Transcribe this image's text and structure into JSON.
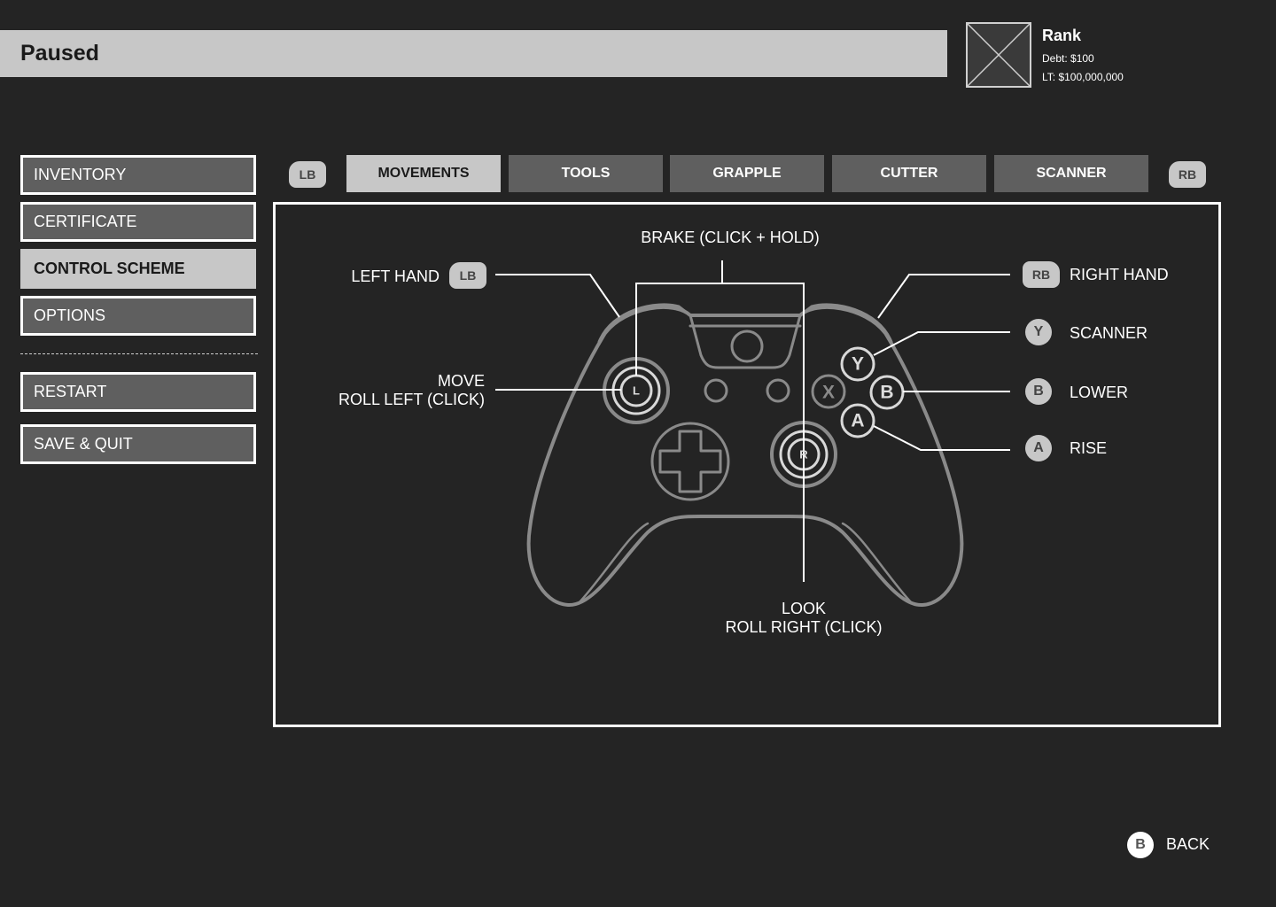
{
  "header": {
    "title": "Paused"
  },
  "rank": {
    "title": "Rank",
    "debt": "Debt: $100",
    "lifetime": "LT: $100,000,000"
  },
  "menu": {
    "items": [
      "INVENTORY",
      "CERTIFICATE",
      "CONTROL SCHEME",
      "OPTIONS"
    ],
    "active": "CONTROL SCHEME",
    "restart": "RESTART",
    "save_quit": "SAVE & QUIT"
  },
  "tabs": {
    "prev_bumper": "LB",
    "next_bumper": "RB",
    "items": [
      "MOVEMENTS",
      "TOOLS",
      "GRAPPLE",
      "CUTTER",
      "SCANNER"
    ],
    "active": "MOVEMENTS"
  },
  "controls": {
    "brake": "BRAKE (CLICK + HOLD)",
    "left_hand": "LEFT HAND",
    "left_hand_button": "LB",
    "right_hand": "RIGHT HAND",
    "right_hand_button": "RB",
    "move_line1": "MOVE",
    "move_line2": "ROLL LEFT (CLICK)",
    "look_line1": "LOOK",
    "look_line2": "ROLL RIGHT (CLICK)",
    "scanner": "SCANNER",
    "scanner_button": "Y",
    "lower": "LOWER",
    "lower_button": "B",
    "rise": "RISE",
    "rise_button": "A"
  },
  "controller": {
    "left_stick": "L",
    "right_stick": "R",
    "face_y": "Y",
    "face_b": "B",
    "face_a": "A",
    "face_x": "X"
  },
  "footer": {
    "back_button": "B",
    "back_label": "BACK"
  }
}
